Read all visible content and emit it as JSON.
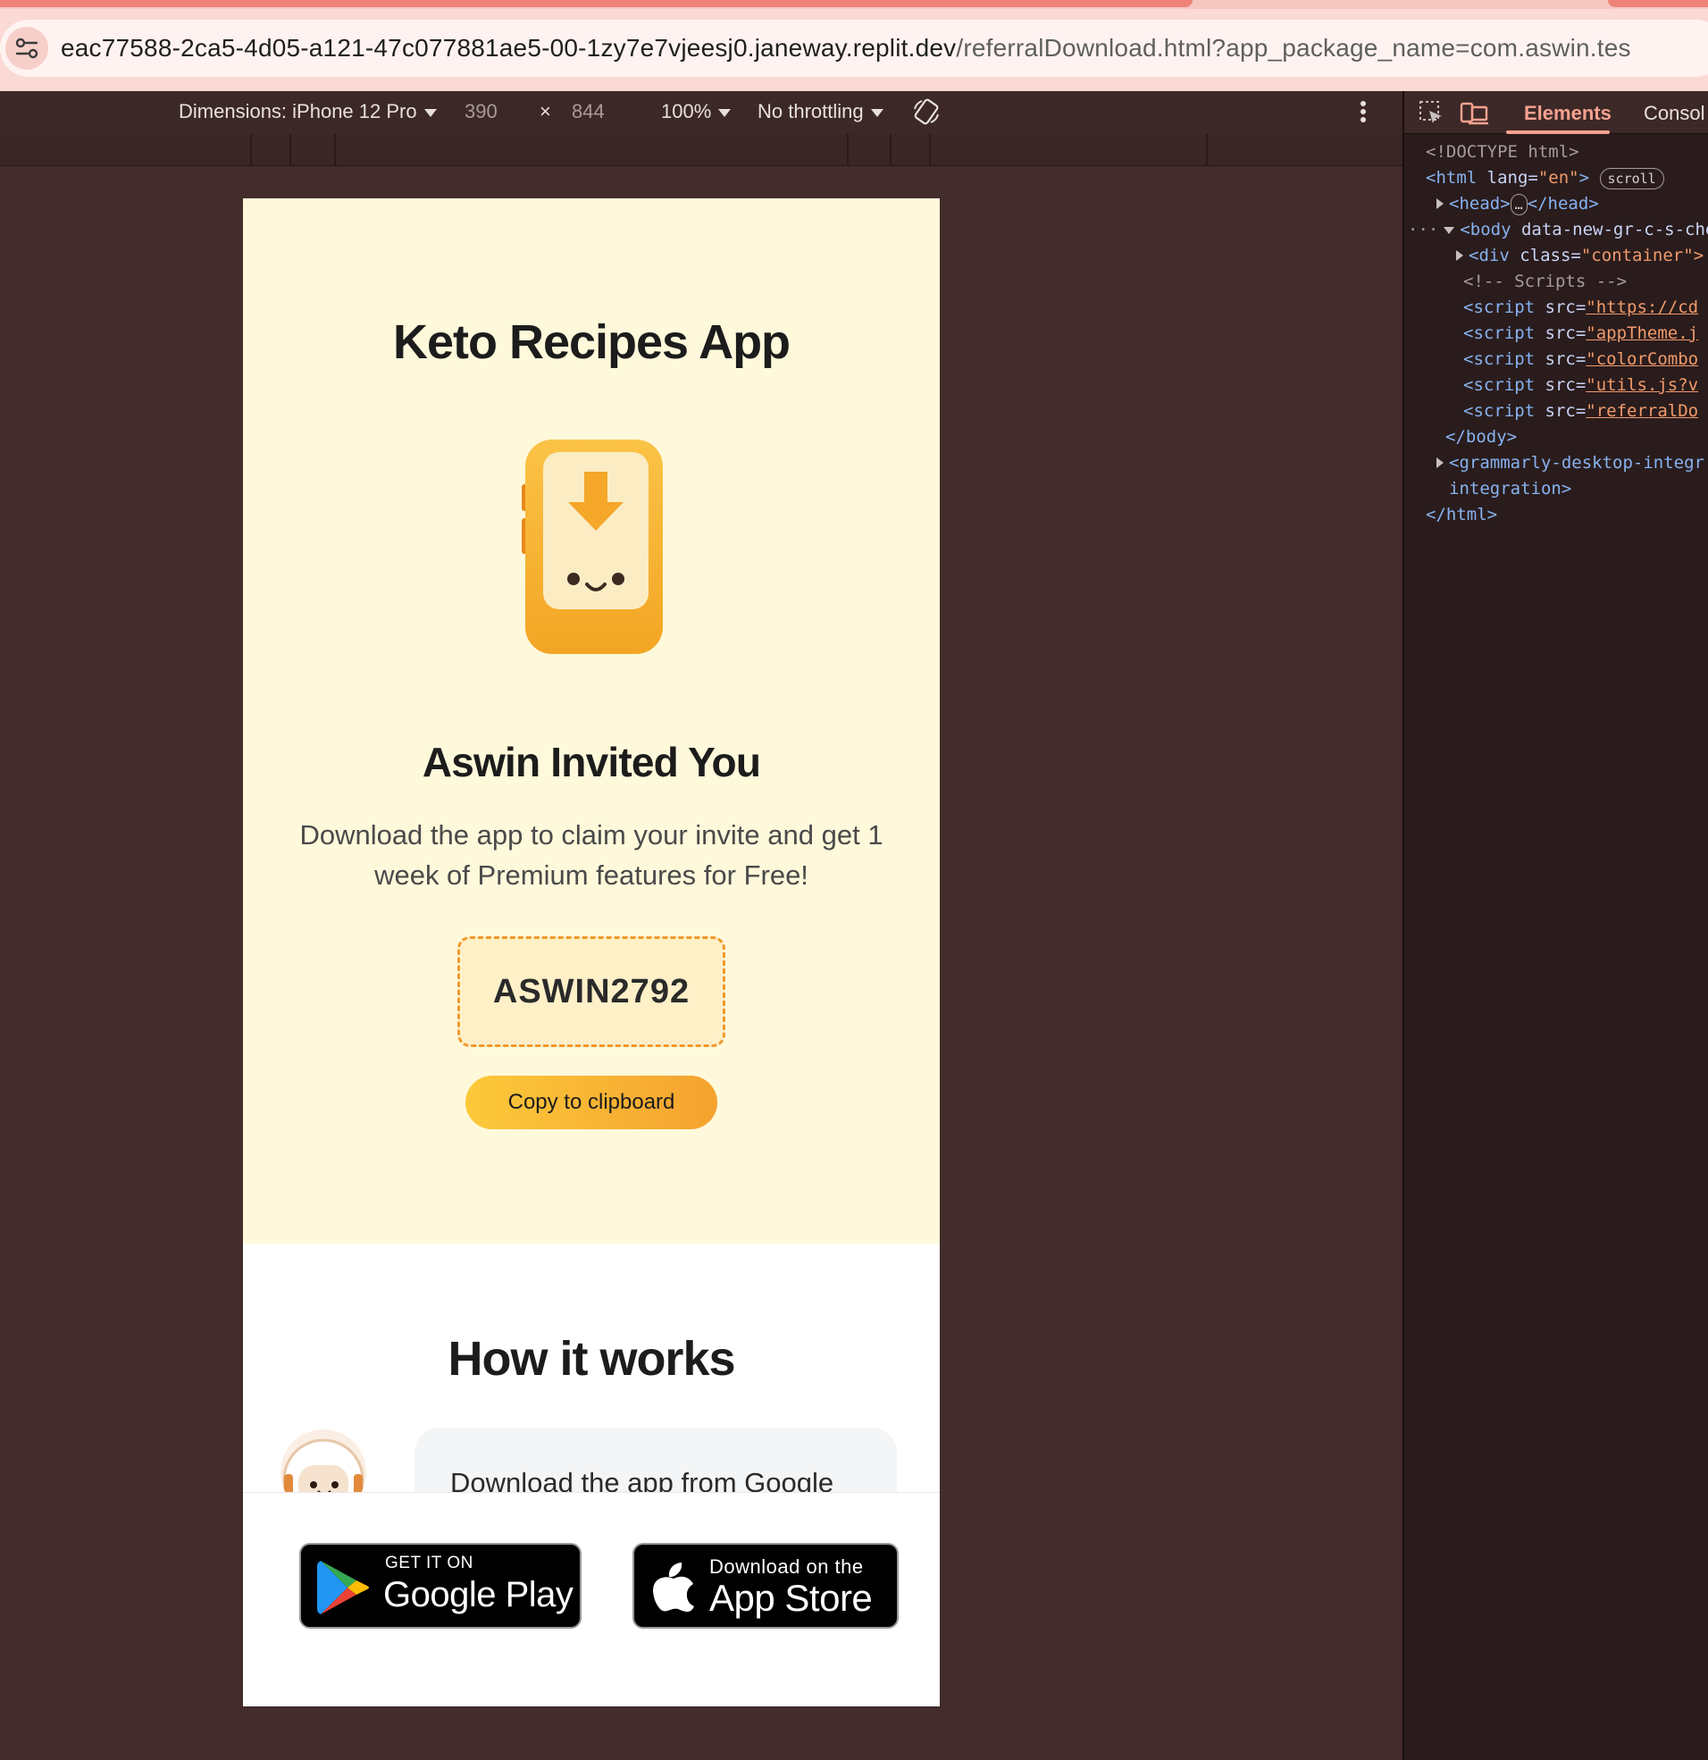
{
  "browser": {
    "url_host": "eac77588-2ca5-4d05-a121-47c077881ae5-00-1zy7e7vjeesj0.janeway.replit.dev",
    "url_path": "/referralDownload.html?app_package_name=com.aswin.tes"
  },
  "device_toolbar": {
    "dimensions_label": "Dimensions: iPhone 12 Pro",
    "width": "390",
    "times": "×",
    "height": "844",
    "zoom": "100%",
    "throttling": "No throttling"
  },
  "page": {
    "app_title": "Keto Recipes App",
    "invite_title": "Aswin Invited You",
    "invite_desc": "Download the app to claim your invite and get 1 week of Premium features for Free!",
    "referral_code": "ASWIN2792",
    "copy_button": "Copy to clipboard",
    "how_title": "How it works",
    "step1_text": "Download the app from Google",
    "google_play": {
      "small": "GET IT ON",
      "big": "Google Play"
    },
    "app_store": {
      "small": "Download on the",
      "big": "App Store"
    }
  },
  "devtools": {
    "tabs": [
      "Elements",
      "Consol"
    ],
    "active_tab": "Elements",
    "lines": {
      "doctype": "<!DOCTYPE html>",
      "html_open": "<html",
      "lang_attr": "lang=",
      "lang_val": "\"en\"",
      "html_close_bracket": ">",
      "scroll_pill": "scroll",
      "head": "<head>",
      "head_dots": "…",
      "head_close": "</head>",
      "body": "<body",
      "body_attr": "data-new-gr-c-s-che",
      "div": "<div",
      "class_attr": "class=",
      "class_val": "\"container\">",
      "comment": "<!-- Scripts -->",
      "script1_src": "\"https://cd",
      "script2_src": "\"appTheme.j",
      "script3_src": "\"colorCombo",
      "script4_src": "\"utils.js?v",
      "script5_src": "\"referralDo",
      "script_open": "<script",
      "src_attr": "src=",
      "body_close": "</body>",
      "grammarly_open": "<grammarly-desktop-integr",
      "grammarly_cont": "integration>",
      "html_close": "</html>"
    }
  },
  "colors": {
    "hero_bg": "#fff9db",
    "accent_orange": "#f5a22f",
    "accent_yellow": "#fcc93a",
    "code_border": "#f19a2e",
    "devtools_accent": "#f7a28f"
  }
}
